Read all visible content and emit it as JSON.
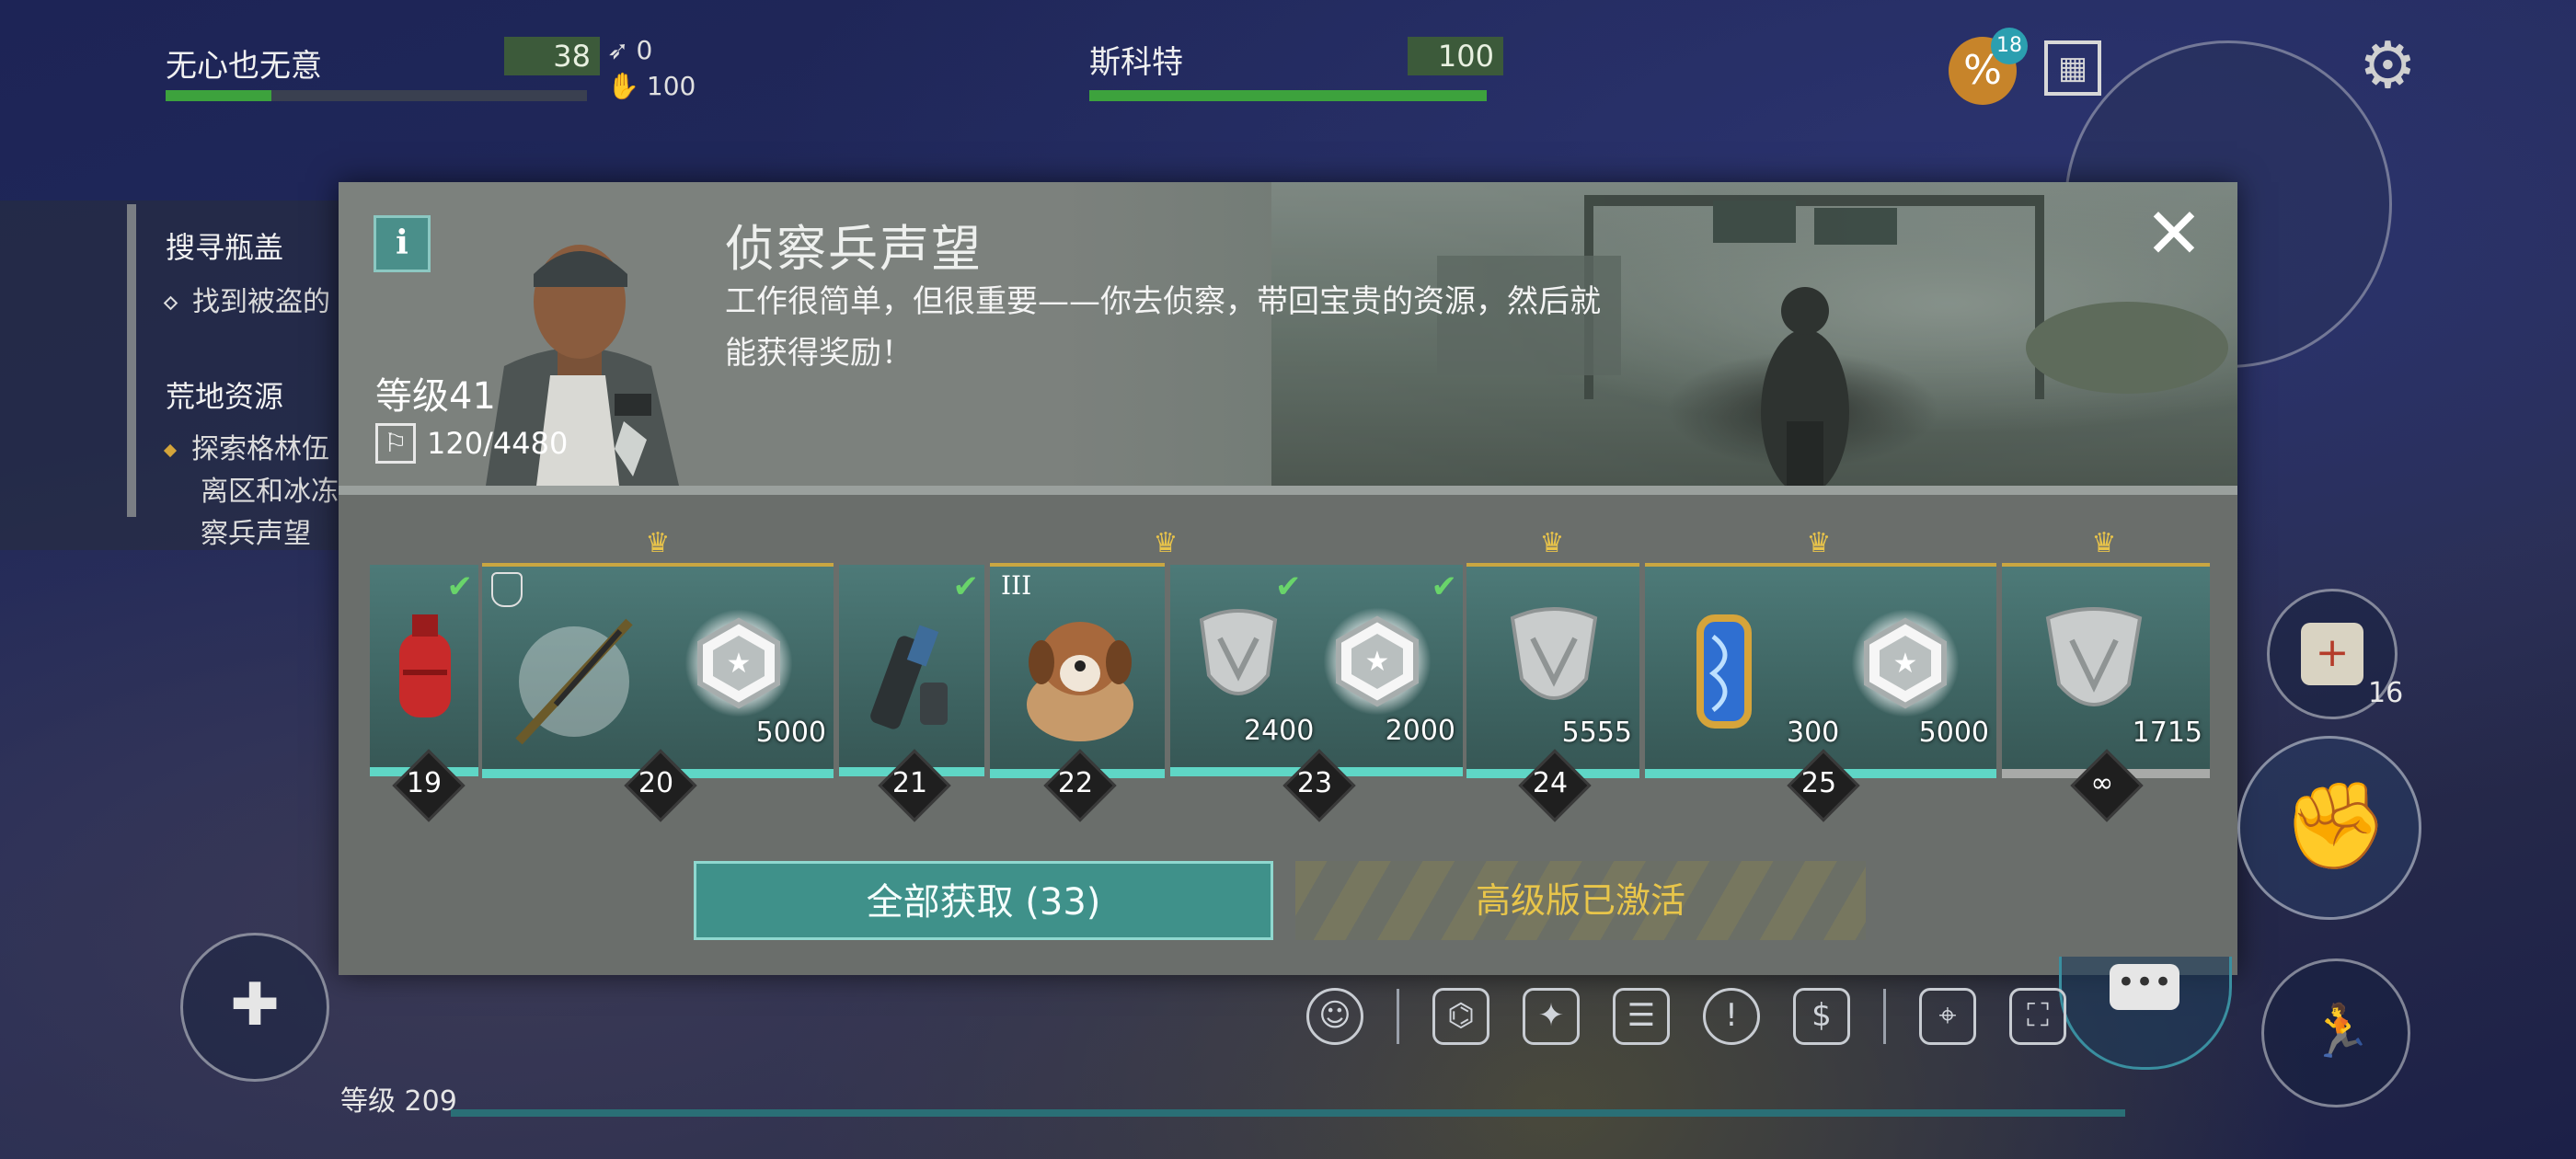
{
  "hud": {
    "player1": {
      "name": "无心也无意",
      "value": "38",
      "health_fraction": 0.25
    },
    "player2": {
      "name": "斯科特",
      "value": "100",
      "health_fraction": 1.0
    },
    "stats": [
      {
        "icon": "bullet-icon",
        "value": "0"
      },
      {
        "icon": "hand-icon",
        "value": "100"
      }
    ],
    "badge_count": "18"
  },
  "quests": {
    "section1_title": "搜寻瓶盖",
    "section1_item": "找到被盗的",
    "section2_title": "荒地资源",
    "section2_line1": "探索格林伍",
    "section2_line2": "离区和冰冻",
    "section2_line3": "察兵声望"
  },
  "modal": {
    "info_label": "i",
    "level": "等级41",
    "xp": "120/4480",
    "title": "侦察兵声望",
    "description": "工作很简单，但很重要——你去侦察，带回宝贵的资源，然后就能获得奖励！",
    "close_label": "✕",
    "claim_all": "全部获取 (33)",
    "premium_status": "高级版已激活",
    "rewards": [
      {
        "level": "19",
        "item": "gas-canister-icon",
        "claimed": true
      },
      {
        "level": "20",
        "item": "sniper-rifle-icon",
        "premium": true,
        "extra": "scout-emblem-icon",
        "qty": "5000"
      },
      {
        "level": "21",
        "item": "weapon-mod-icon",
        "claimed": true
      },
      {
        "level": "22",
        "item": "dog-icon",
        "premium": true,
        "tier": "III"
      },
      {
        "level": "23",
        "item": "silver-badge-icon",
        "qty": "2400",
        "extra": "scout-emblem-icon",
        "qty2": "2000",
        "claimed": true
      },
      {
        "level": "24",
        "item": "silver-badge-icon",
        "premium": true,
        "qty": "5555"
      },
      {
        "level": "25",
        "item": "dna-capsule-icon",
        "premium": true,
        "qty": "300",
        "extra": "scout-emblem-icon",
        "qty2": "5000"
      },
      {
        "level": "∞",
        "item": "silver-badge-icon",
        "premium": true,
        "qty": "1715"
      }
    ]
  },
  "side": {
    "medkit_count": "16"
  },
  "footer": {
    "level": "等级 209"
  }
}
